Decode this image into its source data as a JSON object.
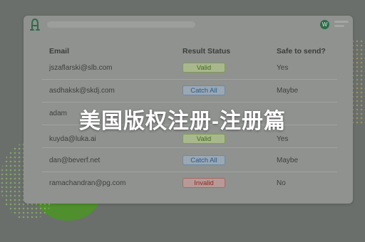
{
  "header": {
    "avatar_initial": "W"
  },
  "table": {
    "columns": {
      "email": "Email",
      "status": "Result Status",
      "safe": "Safe to send?"
    },
    "rows": [
      {
        "email": "jszaflarski@slb.com",
        "status": "Valid",
        "safe": "Yes"
      },
      {
        "email": "asdhaksk@skdj.com",
        "status": "Catch All",
        "safe": "Maybe"
      },
      {
        "email": "adam",
        "status": "",
        "safe": ""
      },
      {
        "email": "kuyda@luka.ai",
        "status": "Valid",
        "safe": "Yes"
      },
      {
        "email": "dan@beverf.net",
        "status": "Catch All",
        "safe": "Maybe"
      },
      {
        "email": "ramachandran@pg.com",
        "status": "Invalid",
        "safe": "No"
      }
    ]
  },
  "overlay": {
    "banner_text": "美国版权注册-注册篇"
  },
  "colors": {
    "valid_bg": "#a9b88c",
    "valid_fg": "#3f6a1e",
    "valid_border": "#7f9a58",
    "catchall_bg": "#9aa8b4",
    "catchall_fg": "#2c5a86",
    "catchall_border": "#7088a0",
    "invalid_bg": "#b79a97",
    "invalid_fg": "#8a2a24",
    "invalid_border": "#a26a64",
    "brand": "#2f6b4a"
  },
  "icons": {
    "logo": "brand-logo-icon",
    "menu": "menu-icon"
  }
}
